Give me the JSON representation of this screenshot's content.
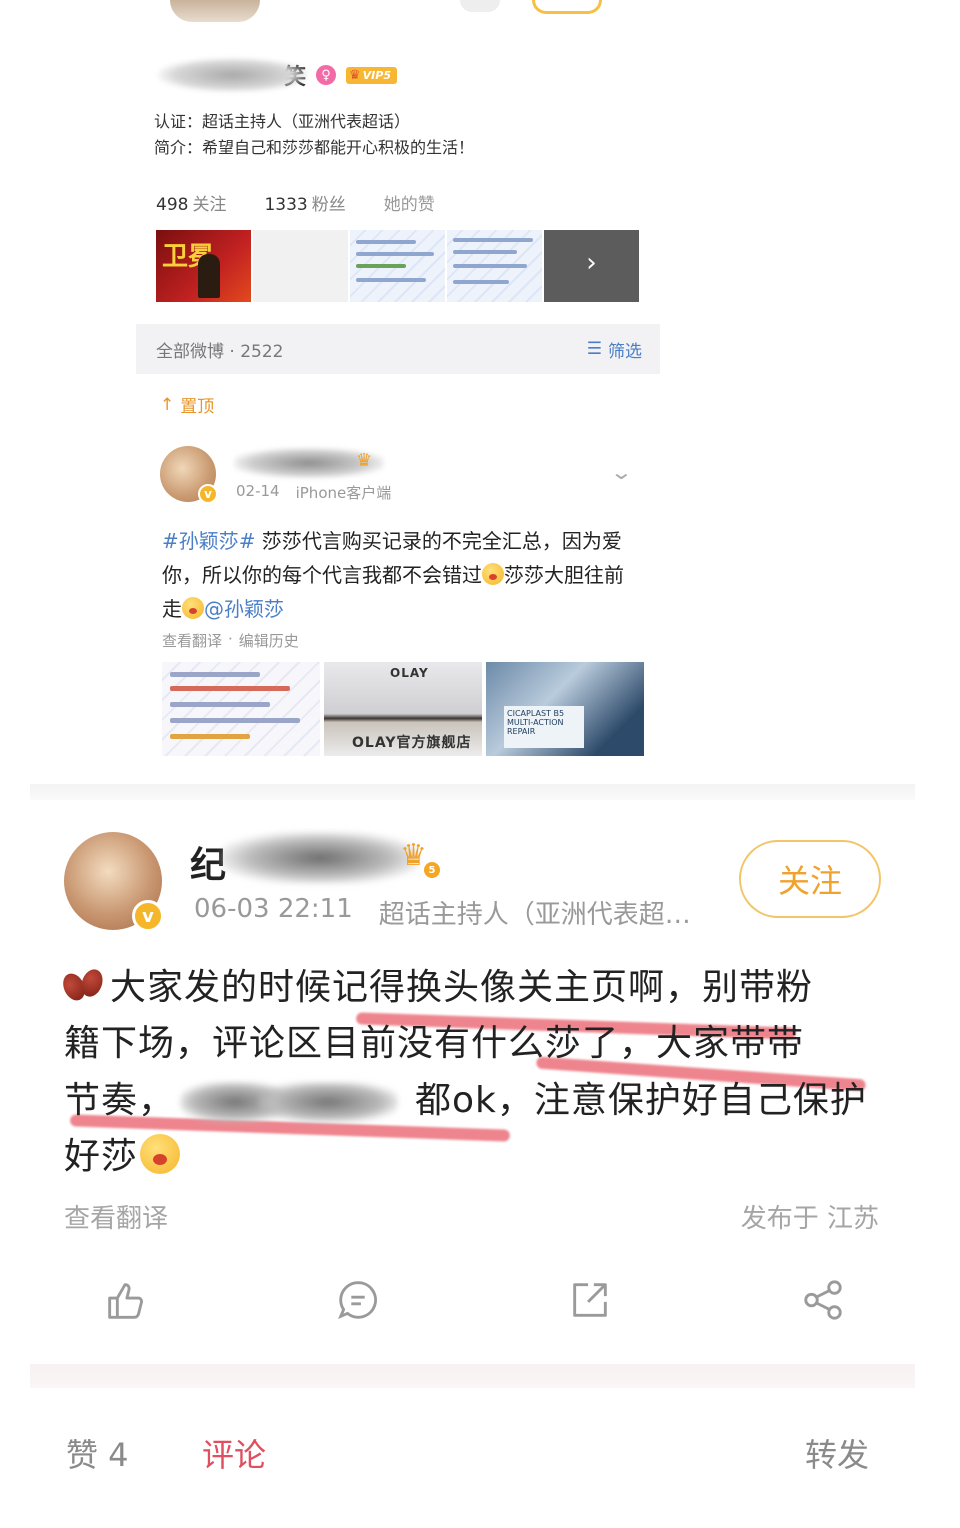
{
  "profile": {
    "name_suffix": "笑",
    "gender_icon": "♀",
    "vip_label": "VIP5",
    "certification": "认证：超话主持人（亚洲代表超话）",
    "bio": "简介：希望自己和莎莎都能开心积极的生活！",
    "following_count": "498",
    "following_label": "关注",
    "followers_count": "1333",
    "followers_label": "粉丝",
    "likes_label": "她的赞",
    "thumb_1_text": "卫冕",
    "filter_count": "全部微博 · 2522",
    "filter_label": "筛选",
    "pinned_label": "置顶"
  },
  "pinned_post": {
    "date": "02-14",
    "source": "iPhone客户端",
    "hashtag": "#孙颖莎#",
    "text_1": " 莎莎代言购买记录的不完全汇总，因为爱你，所以你的每个代言我都不会错过",
    "text_2": "莎莎大胆往前走",
    "mention": "@孙颖莎",
    "translate": "查看翻译",
    "separator": "·",
    "edit_history": "编辑历史",
    "brand_1": "OLAY",
    "brand_2": "OLAY官方旗舰店",
    "product_label": "CICAPLAST B5 MULTI-ACTION REPAIR"
  },
  "comment": {
    "name_first_char": "纪",
    "level": "5",
    "timestamp": "06-03 22:11",
    "certification": "超话主持人（亚洲代表超…",
    "follow_label": "关注",
    "text_line_1": "大家发的时候记得换头像关主页啊，别带粉",
    "text_line_2": "籍下场，评论区目前没有什么莎了，大家带带",
    "text_line_3": "节奏，",
    "text_line_3_b": "都ok，注意保护好自己保护",
    "text_line_4": "好莎",
    "translate": "查看翻译",
    "location": "发布于 江苏",
    "icons": [
      "thumbs-up-icon",
      "comment-icon",
      "share-out-icon",
      "share-nodes-icon"
    ]
  },
  "bottom_tabs": {
    "likes": "赞 4",
    "comments": "评论",
    "reposts": "转发"
  },
  "colors": {
    "accent_link": "#4a7ec6",
    "accent_orange": "#f0a22c",
    "active_tab": "#e04f5f",
    "highlight": "#e85c68"
  }
}
